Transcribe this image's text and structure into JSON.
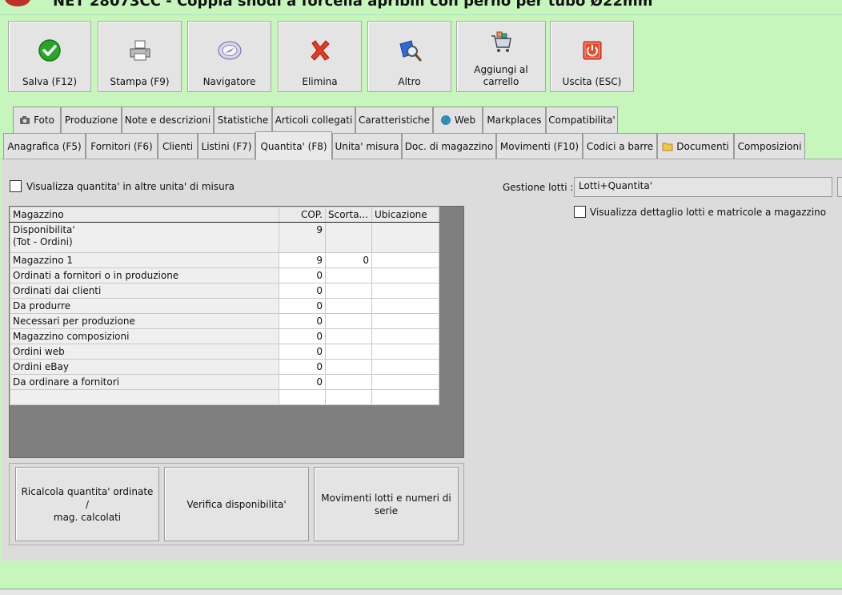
{
  "window": {
    "title": "NET 28073CC - Coppia snodi a forcella apribili con perno per tubo Ø22mm"
  },
  "toolbar": {
    "buttons": [
      {
        "label": "Salva (F12)"
      },
      {
        "label": "Stampa (F9)"
      },
      {
        "label": "Navigatore"
      },
      {
        "label": "Elimina"
      },
      {
        "label": "Altro"
      },
      {
        "label": "Aggiungi al\ncarrello"
      },
      {
        "label": "Uscita (ESC)"
      }
    ]
  },
  "tabs_top": [
    "Foto",
    "Produzione",
    "Note e descrizioni",
    "Statistiche",
    "Articoli collegati",
    "Caratteristiche",
    "Web",
    "Markplaces",
    "Compatibilita'"
  ],
  "tabs_bottom": [
    "Anagrafica (F5)",
    "Fornitori (F6)",
    "Clienti",
    "Listini (F7)",
    "Quantita' (F8)",
    "Unita' misura",
    "Doc. di magazzino",
    "Movimenti (F10)",
    "Codici a barre",
    "Documenti",
    "Composizioni"
  ],
  "options": {
    "show_other_units_label": "Visualizza quantita' in altre unita' di misura",
    "lot_management_label": "Gestione lotti :",
    "lot_management_value": "Lotti+Quantita'",
    "show_lot_detail_label": "Visualizza dettaglio lotti e matricole a magazzino"
  },
  "grid": {
    "columns": [
      "Magazzino",
      "COP.",
      "Scorta...",
      "Ubicazione"
    ],
    "rows": [
      {
        "name": "Disponibilita'\n (Tot - Ordini)",
        "cop": "9",
        "scorta": "",
        "ubicazione": ""
      },
      {
        "name": "Magazzino 1",
        "cop": "9",
        "scorta": "0",
        "ubicazione": ""
      },
      {
        "name": "Ordinati a fornitori o in produzione",
        "cop": "0",
        "scorta": "",
        "ubicazione": ""
      },
      {
        "name": "Ordinati dai clienti",
        "cop": "0",
        "scorta": "",
        "ubicazione": ""
      },
      {
        "name": "Da produrre",
        "cop": "0",
        "scorta": "",
        "ubicazione": ""
      },
      {
        "name": "Necessari per produzione",
        "cop": "0",
        "scorta": "",
        "ubicazione": ""
      },
      {
        "name": "Magazzino composizioni",
        "cop": "0",
        "scorta": "",
        "ubicazione": ""
      },
      {
        "name": "Ordini web",
        "cop": "0",
        "scorta": "",
        "ubicazione": ""
      },
      {
        "name": "Ordini eBay",
        "cop": "0",
        "scorta": "",
        "ubicazione": ""
      },
      {
        "name": "Da ordinare a fornitori",
        "cop": "0",
        "scorta": "",
        "ubicazione": ""
      },
      {
        "name": "",
        "cop": "",
        "scorta": "",
        "ubicazione": ""
      }
    ]
  },
  "actions": {
    "recalc_label": "Ricalcola quantita' ordinate /\nmag. calcolati",
    "verify_label": "Verifica disponibilita'",
    "lots_label": "Movimenti lotti e numeri di\nserie"
  },
  "colors": {
    "background": "#c6f6bc",
    "panel": "#dcdcdc"
  }
}
